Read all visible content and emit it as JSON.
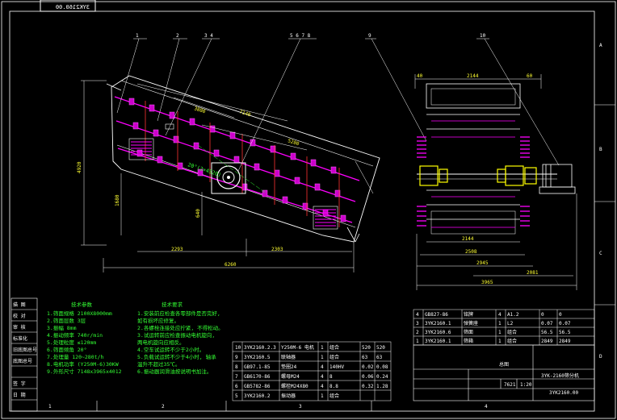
{
  "drawing_id_mirrored": "3YK2160.00",
  "border": {
    "columns": [
      "1",
      "2",
      "3",
      "4"
    ],
    "rows": [
      "A",
      "B",
      "C",
      "D"
    ]
  },
  "balloons": [
    "1",
    "2",
    "3 4",
    "5 6 7 8",
    "9",
    "10"
  ],
  "side_dims": {
    "d3880": "3880",
    "d7140": "7140",
    "d5280": "5280",
    "d4920": "4920",
    "d1680": "1680",
    "d640": "640",
    "d2293": "2293",
    "d2303": "2303",
    "d6260": "6260",
    "d20": "20°(2×4520)"
  },
  "end_dims": {
    "top_left": "40",
    "top_mid": "2144",
    "top_right": "60",
    "b2144": "2144",
    "b2508": "2508",
    "b2945": "2945",
    "b2081": "2081",
    "b3965": "3965"
  },
  "specs": {
    "title": "技术参数",
    "lines": [
      "1.筛面规格     2100X8000mm",
      "2.筛面层数          3层",
      "3.振幅             8mm",
      "4.振动频率       740r/min",
      "5.处理粒度       ≤120mm",
      "6.筛面倾角          20°",
      "7.处理量     120~280t/h",
      "8.电机功率 (Y250M-6)30KW",
      "9.外形尺寸 7148x3965x4012"
    ]
  },
  "requirements": {
    "title": "技术要求",
    "lines": [
      "1.安装前应检查各零部件是否完好,",
      "  如有损坏应修复。",
      "2.各螺栓连接处应拧紧, 不得松动。",
      "3.试运转前应检查振动电机旋向,",
      "  两电机旋向应相反。",
      "4.空车试运转不少于2小时。",
      "5.负载试运转不少于4小时, 轴承",
      "  温升不超过35℃。",
      "6.振动器润滑油按说明书加注。"
    ]
  },
  "left_strip": [
    "描 图",
    "校 对",
    "审 核",
    "标准化",
    "旧底图总号",
    "底图总号",
    "签 字",
    "日 期"
  ],
  "parts_bom": [
    {
      "no": "10",
      "code": "3YK2160.2.3",
      "name": "Y250M-6 电机",
      "qty": "1",
      "mat": "组合",
      "w1": "520",
      "w2": "520"
    },
    {
      "no": "9",
      "code": "3YK2160.5",
      "name": "联轴器",
      "qty": "1",
      "mat": "组合",
      "w1": "63",
      "w2": "63"
    },
    {
      "no": "8",
      "code": "GB97.1-85",
      "name": "垫圈24",
      "qty": "4",
      "mat": "140HV",
      "w1": "0.02",
      "w2": "0.08"
    },
    {
      "no": "7",
      "code": "GB6170-86",
      "name": "螺母M24",
      "qty": "4",
      "mat": "8",
      "w1": "0.06",
      "w2": "0.24"
    },
    {
      "no": "6",
      "code": "GB5782-86",
      "name": "螺栓M24X80",
      "qty": "4",
      "mat": "8.8",
      "w1": "0.32",
      "w2": "1.28"
    },
    {
      "no": "5",
      "code": "3YK2160.2",
      "name": "振动器",
      "qty": "1",
      "mat": "组合",
      "w1": "",
      "w2": ""
    }
  ],
  "parts_bom_right": [
    {
      "no": "4",
      "code": "GB827-86",
      "name": "铭牌",
      "qty": "4",
      "mat": "A1.2",
      "w1": "0",
      "w2": "0"
    },
    {
      "no": "3",
      "code": "3YK2160.1",
      "name": "弹簧座",
      "qty": "1",
      "mat": "L2",
      "w1": "0.07",
      "w2": "0.07"
    },
    {
      "no": "2",
      "code": "3YK2160.6",
      "name": "筛面",
      "qty": "1",
      "mat": "组合",
      "w1": "56.5",
      "w2": "56.5"
    },
    {
      "no": "1",
      "code": "3YK2160.1",
      "name": "筛箱",
      "qty": "1",
      "mat": "组合",
      "w1": "2849",
      "w2": "2849"
    }
  ],
  "title_block": {
    "label": "总图",
    "model": "3YK-2160筛分机",
    "drawing_no": "3YK2160.00",
    "weight": "7621",
    "scale": "1:20"
  }
}
